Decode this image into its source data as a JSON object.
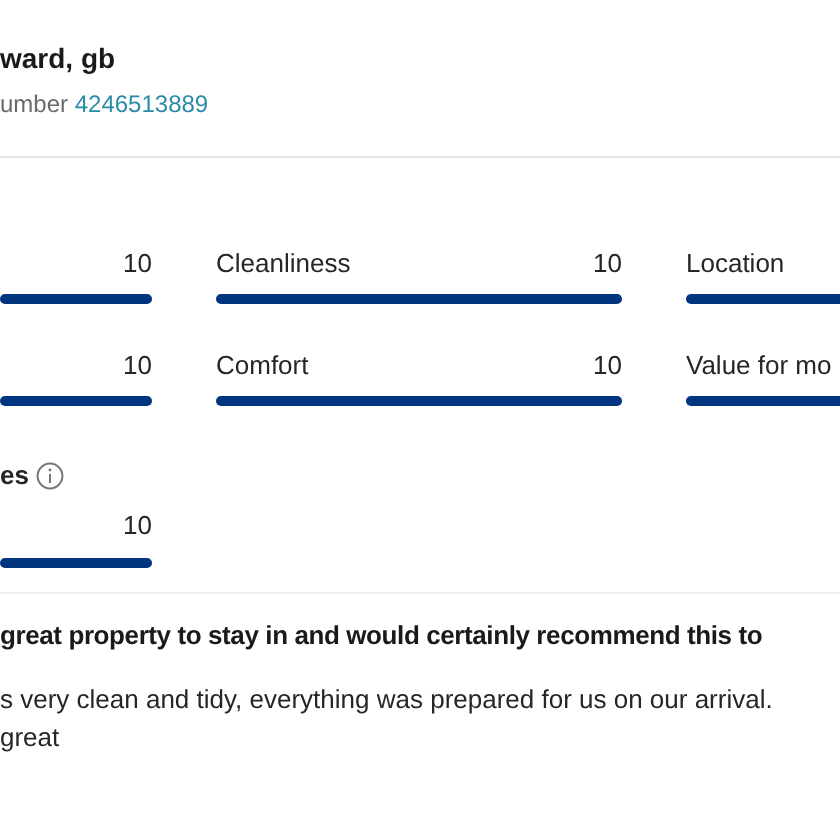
{
  "reviewer": {
    "name": "ward, gb",
    "number_label": "umber",
    "number": "4246513889"
  },
  "scores": [
    {
      "score": "10",
      "level": 1
    },
    {
      "label": "Cleanliness",
      "score": "10",
      "level": 1
    },
    {
      "label": "Location",
      "level": 1
    },
    {
      "score": "10",
      "level": 1
    },
    {
      "label": "Comfort",
      "score": "10",
      "level": 1
    },
    {
      "label": "Value for mo",
      "level": 1
    }
  ],
  "extra": {
    "title": "es",
    "score": "10",
    "level": 1
  },
  "review": {
    "headline": "great property to stay in and would certainly recommend this to",
    "lines": [
      "s very clean and tidy, everything was prepared for us on our arrival.",
      "great"
    ]
  }
}
